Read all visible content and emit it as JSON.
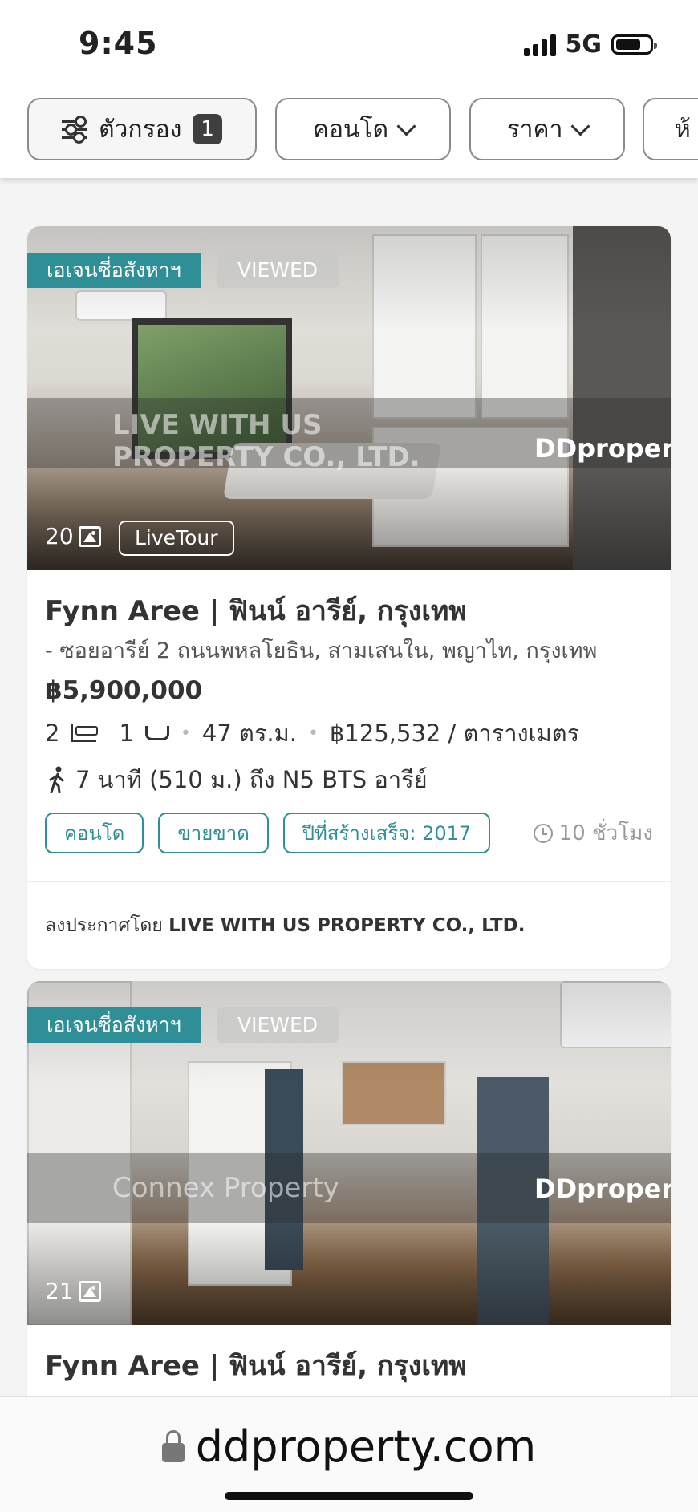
{
  "status_bar": {
    "time": "9:45",
    "network": "5G"
  },
  "filters": {
    "filter_label": "ตัวกรอง",
    "filter_count": "1",
    "property_type": "คอนโด",
    "price": "ราคา",
    "partial_next": "ห้"
  },
  "listings": [
    {
      "agent_tag": "เอเจนซี่อสังหาฯ",
      "viewed_tag": "VIEWED",
      "photo_count": "20",
      "live_tour": "LiveTour",
      "watermark_text": "LIVE WITH US PROPERTY CO., LTD.",
      "watermark_logo": "DDproper",
      "title": "Fynn Aree | ฟินน์ อารีย์, กรุงเทพ",
      "address": "- ซอยอารีย์ 2 ถนนพหลโยธิน, สามเสนใน, พญาไท, กรุงเทพ",
      "price": "฿5,900,000",
      "bedrooms": "2",
      "bathrooms": "1",
      "size": "47 ตร.ม.",
      "price_per_sqm": "฿125,532 / ตารางเมตร",
      "transit": "7 นาที (510 ม.) ถึง N5 BTS อารีย์",
      "tags": [
        "คอนโด",
        "ขายขาด",
        "ปีที่สร้างเสร็จ: 2017"
      ],
      "posted_ago": "10 ชั่วโมง",
      "posted_by_prefix": "ลงประกาศโดย",
      "posted_by": "LIVE WITH US PROPERTY CO., LTD."
    },
    {
      "agent_tag": "เอเจนซี่อสังหาฯ",
      "viewed_tag": "VIEWED",
      "photo_count": "21",
      "watermark_text": "Connex Property",
      "watermark_logo": "DDproper",
      "title": "Fynn Aree | ฟินน์ อารีย์, กรุงเทพ"
    }
  ],
  "browser": {
    "url": "ddproperty.com"
  },
  "colors": {
    "accent": "#2f8f96",
    "badge": "#3f3f3f"
  }
}
